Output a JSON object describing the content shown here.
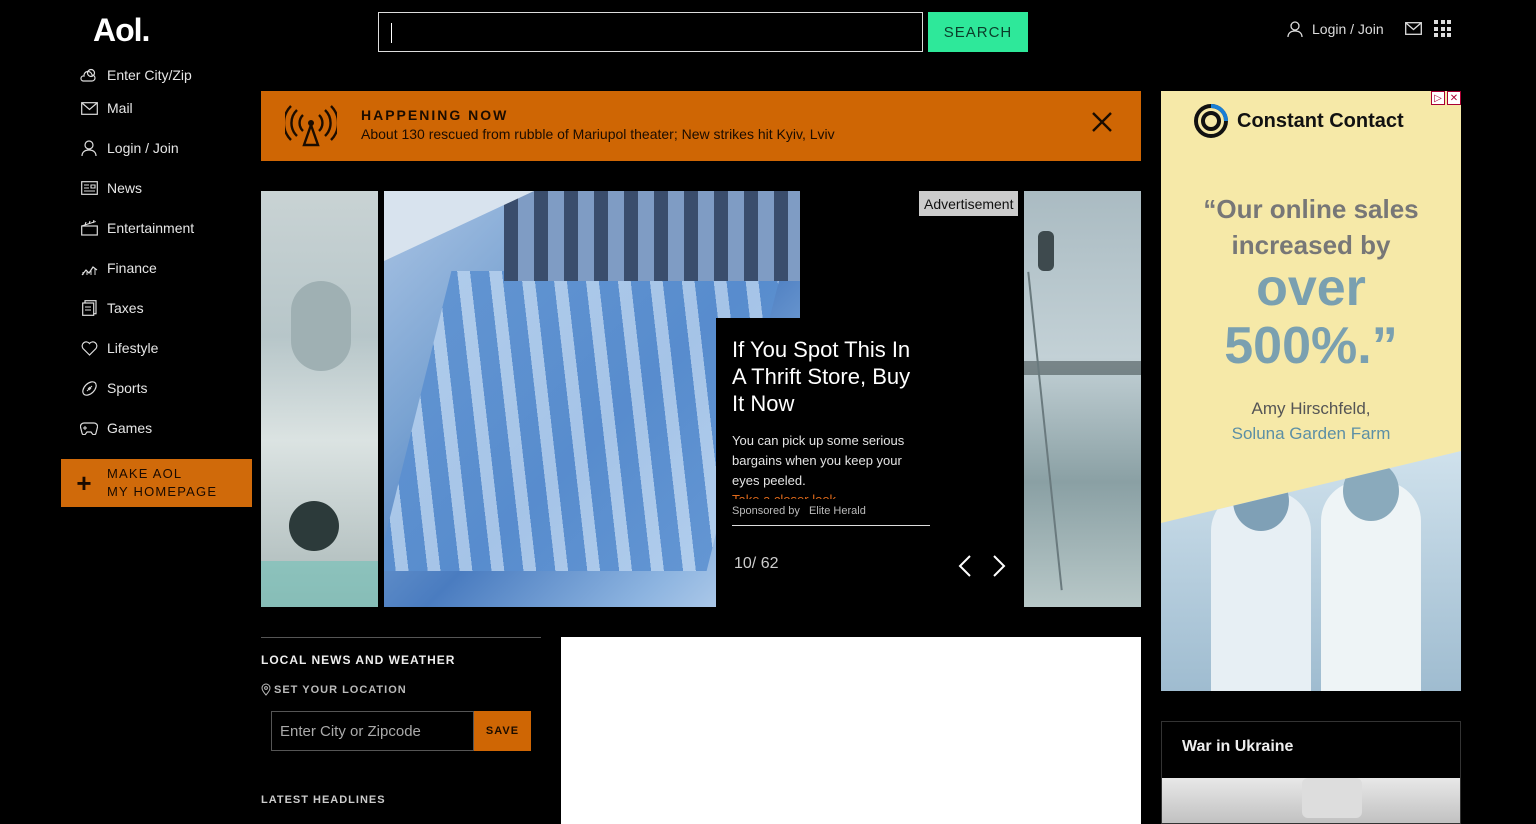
{
  "header": {
    "logo": "Aol.",
    "search": {
      "value": "",
      "button_label": "SEARCH"
    },
    "login_label": "Login / Join"
  },
  "sidebar": {
    "items": [
      {
        "label": "Enter City/Zip",
        "icon": "weather-icon"
      },
      {
        "label": "Mail",
        "icon": "mail-icon"
      },
      {
        "label": "Login / Join",
        "icon": "user-icon"
      },
      {
        "label": "News",
        "icon": "news-icon"
      },
      {
        "label": "Entertainment",
        "icon": "clapper-icon"
      },
      {
        "label": "Finance",
        "icon": "chart-icon"
      },
      {
        "label": "Taxes",
        "icon": "document-icon"
      },
      {
        "label": "Lifestyle",
        "icon": "heart-icon"
      },
      {
        "label": "Sports",
        "icon": "football-icon"
      },
      {
        "label": "Games",
        "icon": "gamepad-icon"
      }
    ],
    "make_homepage": {
      "line1": "MAKE AOL",
      "line2": "MY HOMEPAGE"
    }
  },
  "happening_now": {
    "kicker": "HAPPENING NOW",
    "headline": "About 130 rescued from rubble of Mariupol theater; New strikes hit Kyiv, Lviv"
  },
  "carousel": {
    "ad_label": "Advertisement",
    "title": "If You Spot This In A Thrift Store, Buy It Now",
    "description": "You can pick up some serious bargains when you keep your eyes peeled.",
    "more_link": "Take a closer look",
    "sponsored_by": "Sponsored by",
    "sponsor": "Elite Herald",
    "counter": "10/ 62"
  },
  "local": {
    "heading": "LOCAL NEWS AND WEATHER",
    "set_location": "SET YOUR LOCATION",
    "input_placeholder": "Enter City or Zipcode",
    "save_label": "SAVE",
    "latest_heading": "LATEST HEADLINES"
  },
  "ad_right": {
    "brand": "Constant Contact",
    "quote_line1": "“Our online sales",
    "quote_line2": "increased by",
    "quote_line3": "over",
    "quote_line4": "500%.”",
    "person": "Amy Hirschfeld,",
    "company": "Soluna Garden Farm"
  },
  "war_card": {
    "title": "War in Ukraine"
  },
  "colors": {
    "accent_orange": "#cf6604",
    "search_green": "#2ee89a",
    "background": "#000000"
  }
}
